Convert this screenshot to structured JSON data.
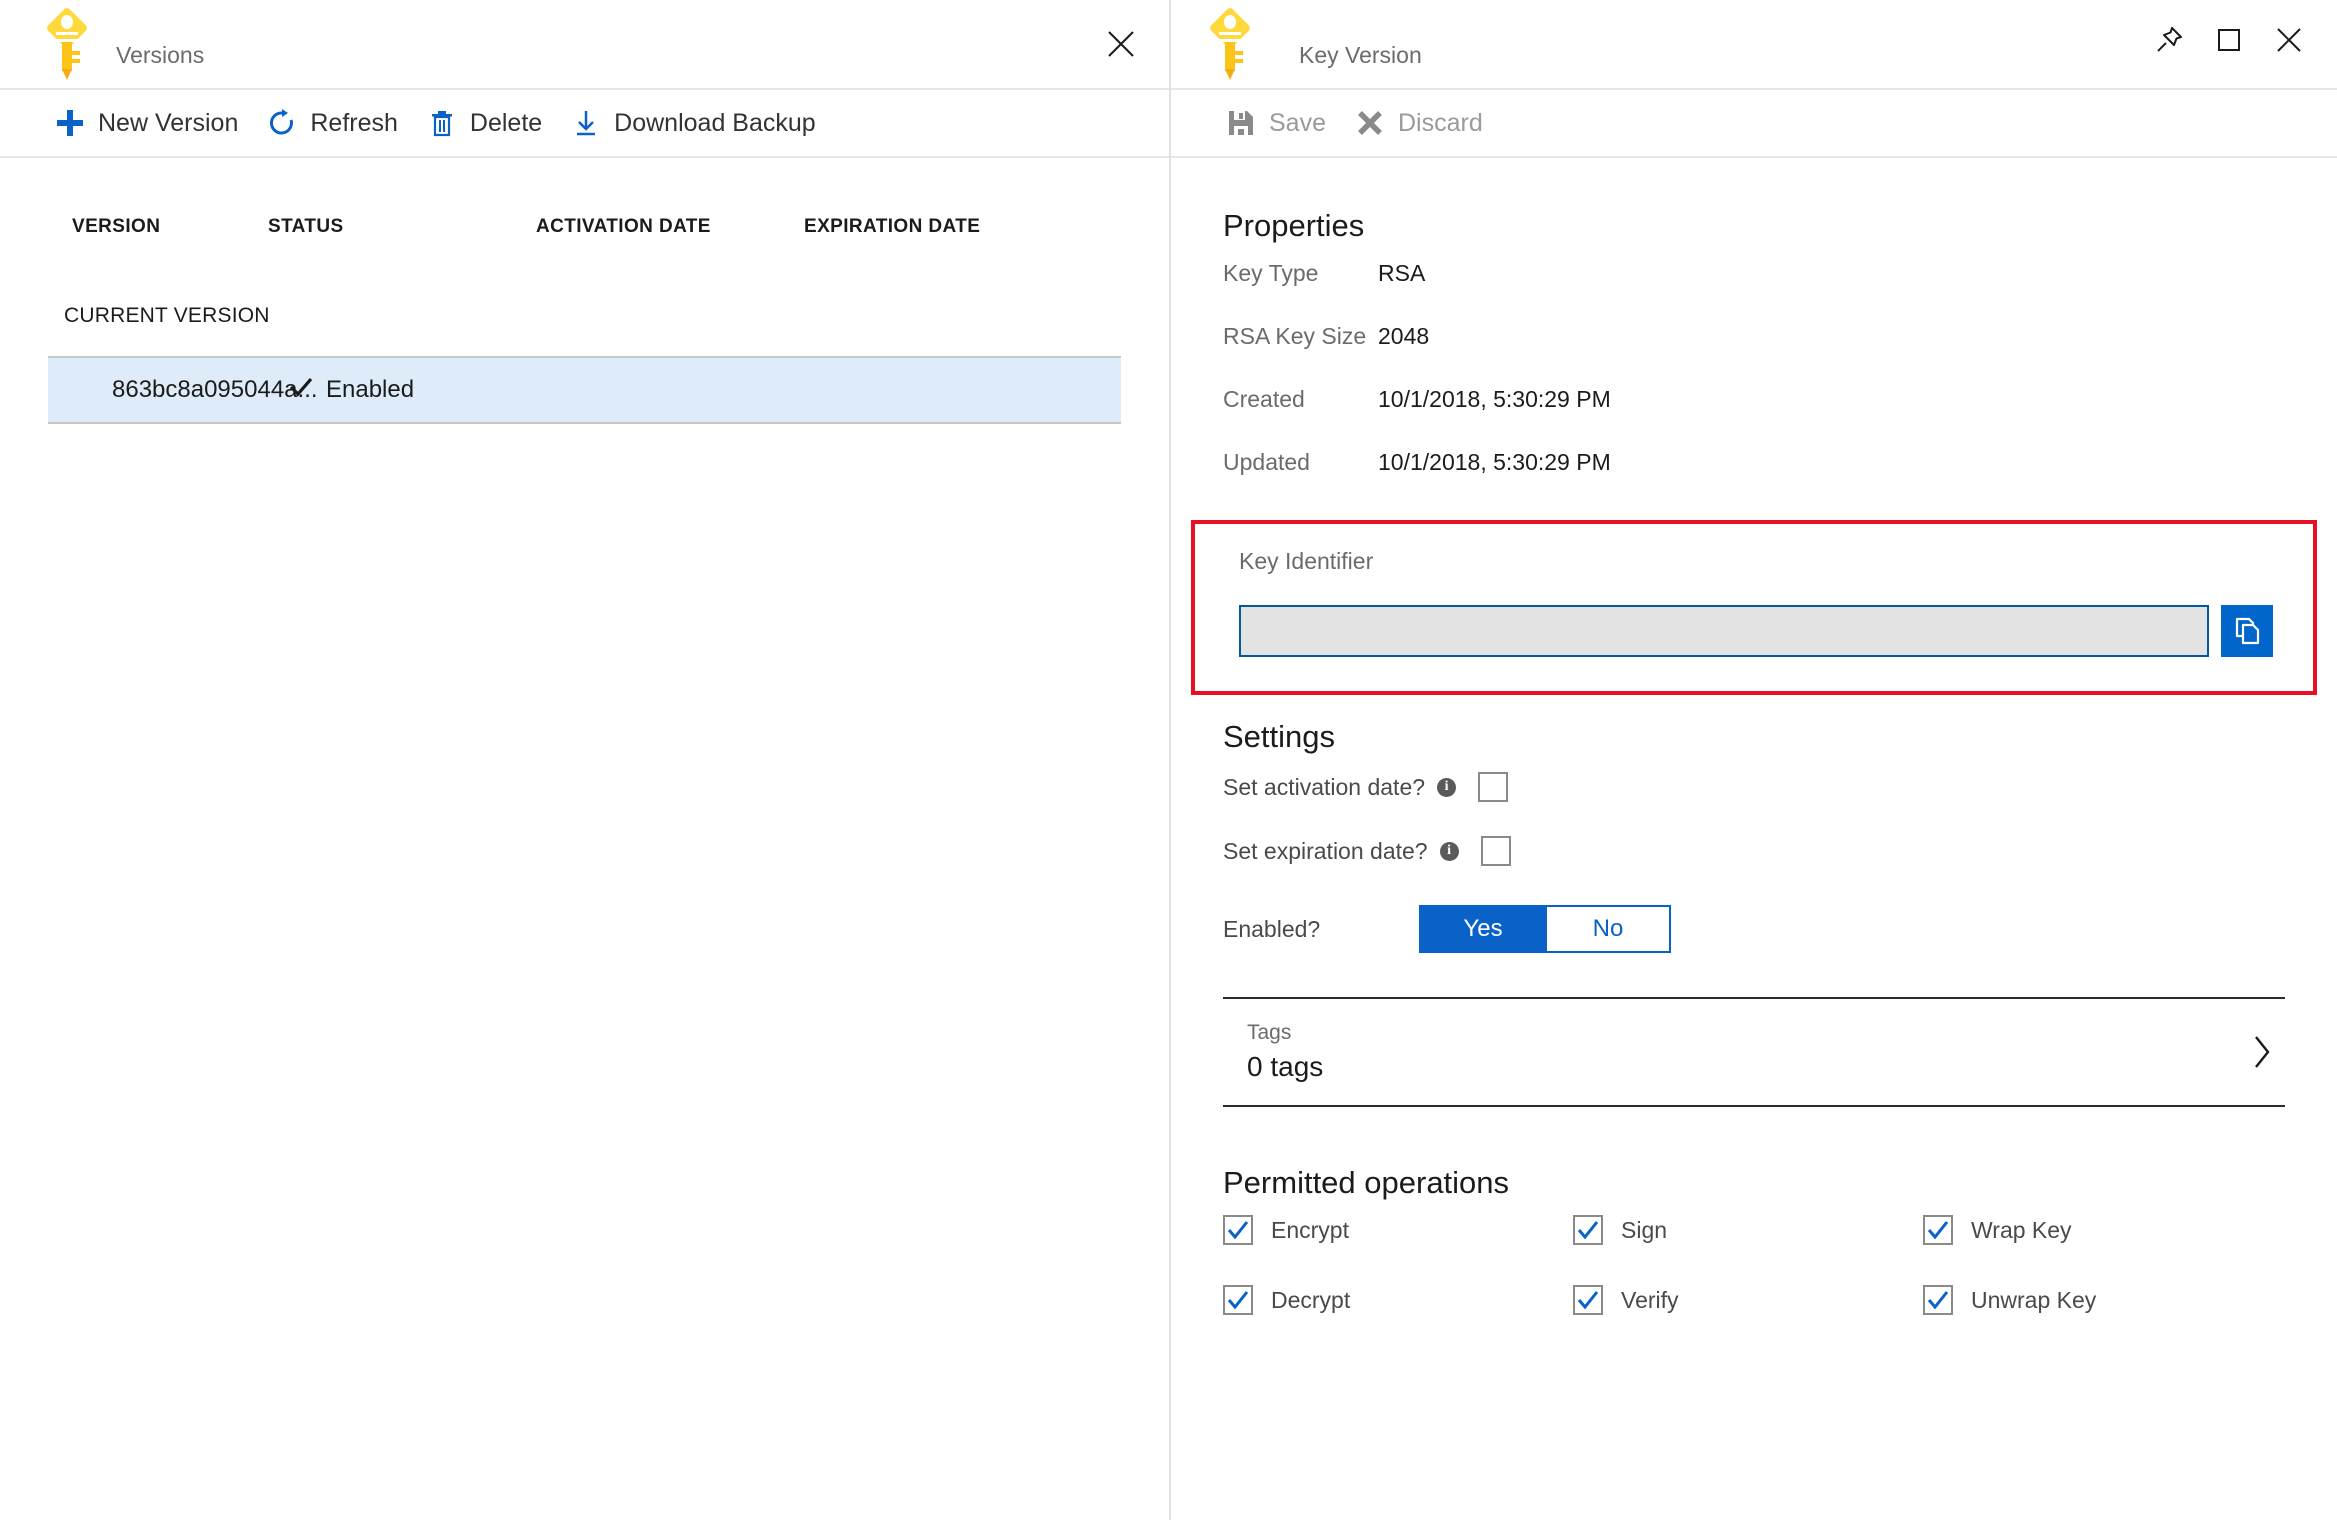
{
  "left_blade": {
    "title": "Versions",
    "icon": "key-icon",
    "close_label": "",
    "toolbar": [
      {
        "label": "New Version",
        "icon": "plus-icon"
      },
      {
        "label": "Refresh",
        "icon": "refresh-icon"
      },
      {
        "label": "Delete",
        "icon": "trash-icon"
      },
      {
        "label": "Download Backup",
        "icon": "download-icon"
      }
    ],
    "table": {
      "columns": [
        "VERSION",
        "STATUS",
        "ACTIVATION DATE",
        "EXPIRATION DATE"
      ],
      "group_label": "CURRENT VERSION",
      "rows": [
        {
          "version": "863bc8a095044a...",
          "status": "Enabled",
          "status_icon": "check-icon",
          "activation_date": "",
          "expiration_date": "",
          "selected": true
        }
      ]
    }
  },
  "right_blade": {
    "title": "Key Version",
    "icon": "key-icon",
    "window_controls": [
      {
        "name": "pin-icon"
      },
      {
        "name": "maximize-icon"
      },
      {
        "name": "close-icon"
      }
    ],
    "toolbar": [
      {
        "label": "Save",
        "icon": "save-icon",
        "disabled": true
      },
      {
        "label": "Discard",
        "icon": "discard-icon",
        "disabled": true
      }
    ],
    "properties": {
      "heading": "Properties",
      "items": [
        {
          "key": "Key Type",
          "value": "RSA"
        },
        {
          "key": "RSA Key Size",
          "value": "2048"
        },
        {
          "key": "Created",
          "value": "10/1/2018, 5:30:29 PM"
        },
        {
          "key": "Updated",
          "value": "10/1/2018, 5:30:29 PM"
        }
      ]
    },
    "key_identifier": {
      "label": "Key Identifier",
      "value": "",
      "placeholder": "",
      "copy_icon": "copy-icon",
      "highlight_color": "#e81123"
    },
    "settings": {
      "heading": "Settings",
      "set_activation_date": {
        "label": "Set activation date?",
        "info_icon": "info-icon",
        "checked": false
      },
      "set_expiration_date": {
        "label": "Set expiration date?",
        "info_icon": "info-icon",
        "checked": false
      },
      "enabled": {
        "label": "Enabled?",
        "yes_label": "Yes",
        "no_label": "No",
        "selected": "Yes"
      }
    },
    "tags": {
      "label": "Tags",
      "count_text": "0 tags",
      "chevron_icon": "chevron-right-icon"
    },
    "permitted_operations": {
      "heading": "Permitted operations",
      "items": [
        {
          "label": "Encrypt",
          "checked": true
        },
        {
          "label": "Sign",
          "checked": true
        },
        {
          "label": "Wrap Key",
          "checked": true
        },
        {
          "label": "Decrypt",
          "checked": true
        },
        {
          "label": "Verify",
          "checked": true
        },
        {
          "label": "Unwrap Key",
          "checked": true
        }
      ]
    }
  },
  "colors": {
    "accent_blue": "#0a62c9",
    "link_blue": "#0066cc",
    "selected_row": "#deecf9",
    "highlight_red": "#e81123",
    "key_yellow": "#ffd93b",
    "disabled_gray": "#9a9a9a"
  }
}
